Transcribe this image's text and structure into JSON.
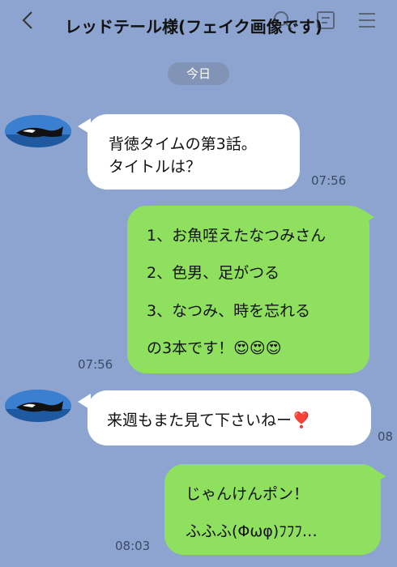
{
  "header": {
    "title": "レッドテール様(フェイク画像です)",
    "back_icon": "chevron-left-icon",
    "search_icon": "search-icon",
    "note_icon": "note-icon",
    "menu_icon": "hamburger-menu-icon"
  },
  "date_chip": "今日",
  "colors": {
    "background": "#8ca4cf",
    "incoming_bubble": "#ffffff",
    "outgoing_bubble": "#8fe05f"
  },
  "messages": [
    {
      "direction": "in",
      "lines": [
        "背徳タイムの第3話。",
        "タイトルは？"
      ],
      "time": "07:56"
    },
    {
      "direction": "out",
      "lines": [
        "1、お魚咥えたなつみさん",
        "2、色男、足がつる",
        "3、なつみ、時を忘れる",
        "の3本です！😍😍😍"
      ],
      "time": "07:56"
    },
    {
      "direction": "in",
      "lines": [
        "来週もまた見て下さいねー❣️"
      ],
      "time": "08"
    },
    {
      "direction": "out",
      "lines": [
        "じゃんけんポン！",
        "ふふふ(Φωφ)ﾌﾌﾌ…"
      ],
      "time": "08:03"
    }
  ]
}
